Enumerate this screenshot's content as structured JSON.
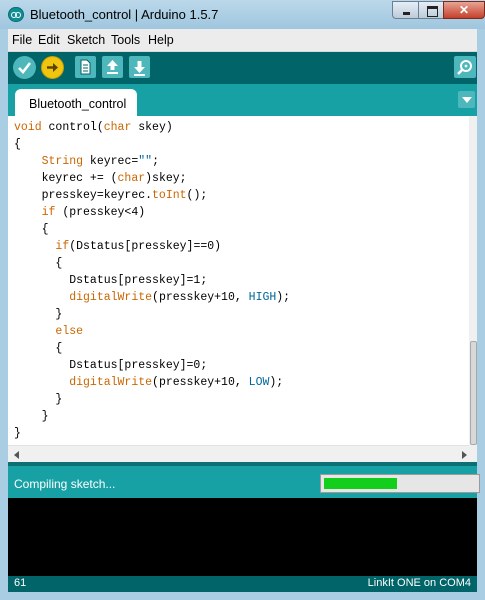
{
  "window": {
    "title": "Bluetooth_control | Arduino 1.5.7"
  },
  "menubar": {
    "items": [
      "File",
      "Edit",
      "Sketch",
      "Tools",
      "Help"
    ]
  },
  "toolbar": {
    "buttons": [
      "verify-icon",
      "upload-icon",
      "new-icon",
      "open-icon",
      "save-icon",
      "serial-monitor-icon"
    ]
  },
  "tabs": [
    {
      "label": "Bluetooth_control"
    }
  ],
  "editor": {
    "lines": [
      [
        [
          "void",
          "kw"
        ],
        [
          " control(",
          ""
        ],
        [
          "char",
          "kw"
        ],
        [
          " skey)",
          ""
        ]
      ],
      [
        [
          "{",
          ""
        ]
      ],
      [
        [
          "    ",
          ""
        ],
        [
          "String",
          "kw"
        ],
        [
          " keyrec=",
          ""
        ],
        [
          "\"\"",
          "str"
        ],
        [
          ";",
          ""
        ]
      ],
      [
        [
          "    keyrec += (",
          ""
        ],
        [
          "char",
          "kw"
        ],
        [
          ")skey;",
          ""
        ]
      ],
      [
        [
          "    presskey=keyrec.",
          ""
        ],
        [
          "toInt",
          "kw"
        ],
        [
          "();",
          ""
        ]
      ],
      [
        [
          "    ",
          ""
        ],
        [
          "if",
          "kw"
        ],
        [
          " (presskey<4)",
          ""
        ]
      ],
      [
        [
          "    {",
          ""
        ]
      ],
      [
        [
          "      ",
          ""
        ],
        [
          "if",
          "kw"
        ],
        [
          "(Dstatus[presskey]==0)",
          ""
        ]
      ],
      [
        [
          "      {",
          ""
        ]
      ],
      [
        [
          "        Dstatus[presskey]=1;",
          ""
        ]
      ],
      [
        [
          "        ",
          ""
        ],
        [
          "digitalWrite",
          "kw"
        ],
        [
          "(presskey+10, ",
          ""
        ],
        [
          "HIGH",
          "ty"
        ],
        [
          ");",
          ""
        ]
      ],
      [
        [
          "      }",
          ""
        ]
      ],
      [
        [
          "      ",
          ""
        ],
        [
          "else",
          "kw"
        ]
      ],
      [
        [
          "      {",
          ""
        ]
      ],
      [
        [
          "        Dstatus[presskey]=0;",
          ""
        ]
      ],
      [
        [
          "        ",
          ""
        ],
        [
          "digitalWrite",
          "kw"
        ],
        [
          "(presskey+10, ",
          ""
        ],
        [
          "LOW",
          "ty"
        ],
        [
          ");",
          ""
        ]
      ],
      [
        [
          "      }",
          ""
        ]
      ],
      [
        [
          "    }",
          ""
        ]
      ],
      [
        [
          "}",
          ""
        ]
      ]
    ]
  },
  "status": {
    "text": "Compiling sketch...",
    "progress": 0.48
  },
  "footer": {
    "line_number": "61",
    "board": "LinkIt ONE on COM4"
  },
  "colors": {
    "toolbar": "#006468",
    "tabbar": "#17a1a5",
    "keyword": "#cc6600",
    "constant": "#006699",
    "progress_fill": "#13cf1b"
  }
}
